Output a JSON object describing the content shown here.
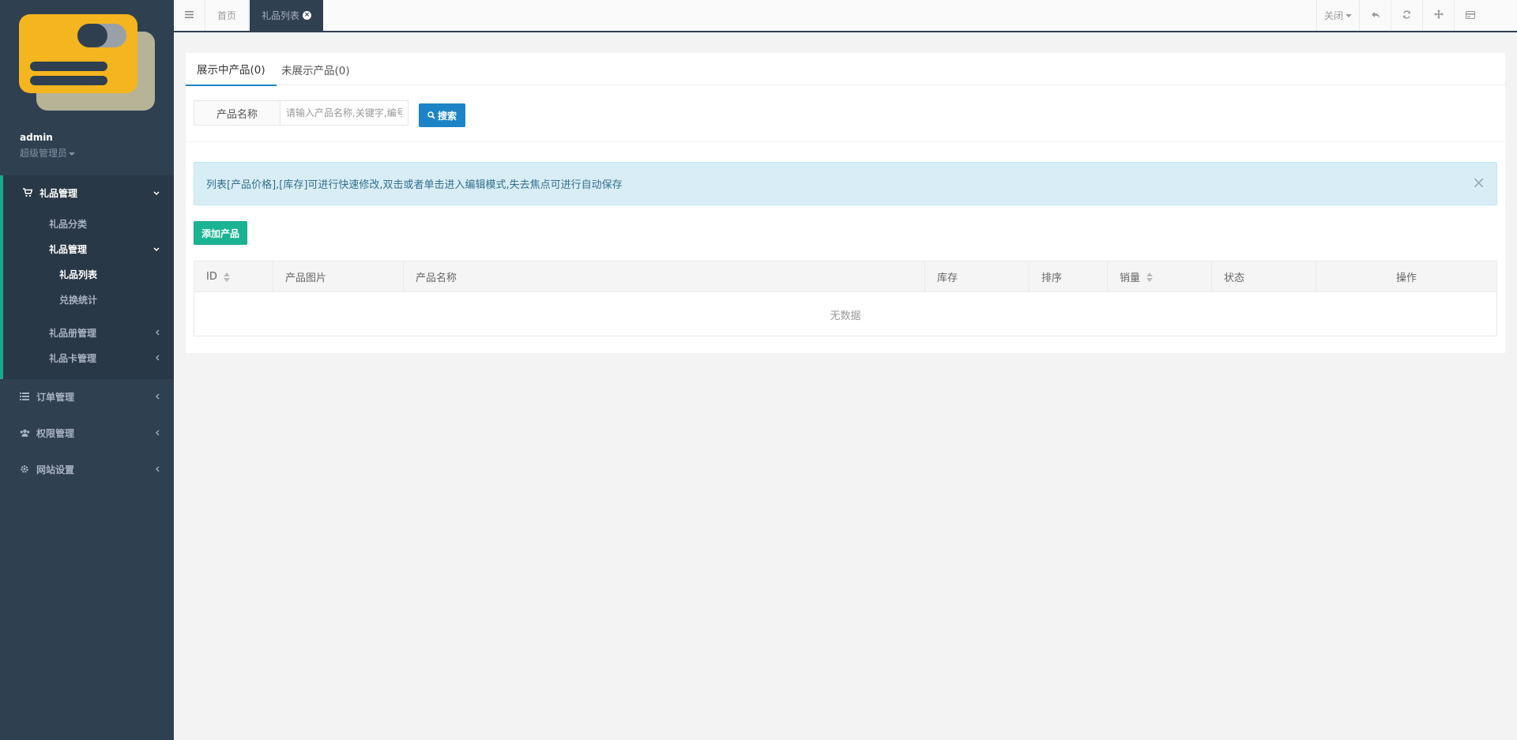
{
  "sidebar": {
    "user_name": "admin",
    "user_role": "超级管理员",
    "menu": {
      "gift_mgmt": "礼品管理",
      "gift_category": "礼品分类",
      "gift_mgmt_sub": "礼品管理",
      "gift_list": "礼品列表",
      "redeem_stats": "兑换统计",
      "gift_book_mgmt": "礼品册管理",
      "gift_card_mgmt": "礼品卡管理",
      "order_mgmt": "订单管理",
      "permission_mgmt": "权限管理",
      "site_settings": "网站设置"
    }
  },
  "topbar": {
    "home_tab": "首页",
    "current_tab": "礼品列表",
    "close_label": "关闭"
  },
  "content": {
    "tabs": {
      "showing": "展示中产品(0)",
      "not_showing": "未展示产品(0)"
    },
    "search": {
      "label": "产品名称",
      "placeholder": "请输入产品名称,关键字,编号",
      "button": "搜索"
    },
    "alert": "列表[产品价格],[库存]可进行快速修改,双击或者单击进入编辑模式,失去焦点可进行自动保存",
    "add_button": "添加产品",
    "table": {
      "columns": [
        "ID",
        "产品图片",
        "产品名称",
        "库存",
        "排序",
        "销量",
        "状态",
        "操作"
      ],
      "empty_text": "无数据"
    }
  },
  "colors": {
    "sidebar_bg": "#2f4050",
    "primary_blue": "#1c84c6",
    "primary_green": "#1ab394",
    "alert_bg": "#d9edf7"
  }
}
